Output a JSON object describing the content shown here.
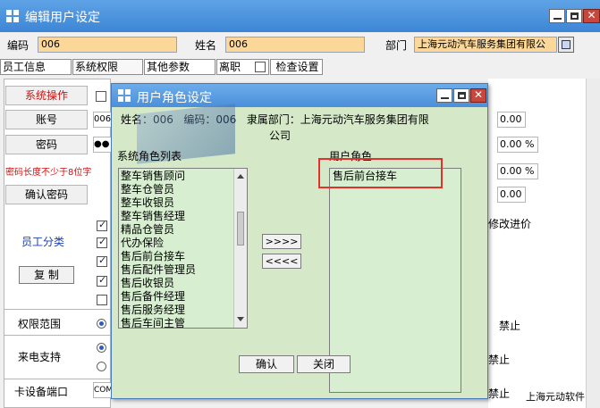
{
  "main_window": {
    "title": "编辑用户设定",
    "code_label": "编码",
    "code_value": "006",
    "name_label": "姓名",
    "name_value": "006",
    "dept_label": "部门",
    "dept_value": "上海元动汽车服务集团有限公",
    "tabs": [
      "员工信息",
      "系统权限",
      "其他参数",
      "离职",
      "检查设置"
    ],
    "rows": {
      "system_ops": "系统操作",
      "account": "账号",
      "account_value": "006",
      "password": "密码",
      "password_value": "●●",
      "password_hint": "密码长度不少于8位字",
      "confirm_password": "确认密码",
      "employee_class": "员工分类",
      "copy_button": "复 制",
      "permission_scope": "权限范围",
      "call_support": "来电支持",
      "card_port": "卡设备端口",
      "card_port_value": "COM"
    },
    "right_values": [
      "0.00",
      "0.00 %",
      "0.00 %",
      "0.00"
    ],
    "right_texts": {
      "modify_price": "修改进价",
      "forbid1": "禁止",
      "forbid2": "禁止",
      "forbid3": "禁止"
    },
    "footer_brand": "上海元动软件"
  },
  "dialog": {
    "title": "用户角色设定",
    "info_line1": "姓名：006   编码：006   隶属部门：上海元动汽车服务集团有限",
    "info_line2": "公司",
    "system_roles_label": "系统角色列表",
    "user_roles_label": "用户角色",
    "system_roles": [
      "整车销售顾问",
      "整车仓管员",
      "整车收银员",
      "整车销售经理",
      "精品仓管员",
      "代办保险",
      "售后前台接车",
      "售后配件管理员",
      "售后收银员",
      "售后备件经理",
      "售后服务经理",
      "售后车间主管"
    ],
    "user_roles": [
      "售后前台接车"
    ],
    "add_button": ">>>>",
    "remove_button": "<<<<",
    "ok_button": "确认",
    "close_button": "关闭"
  },
  "colors": {
    "title_bar": "#3d86d6",
    "dialog_bg": "#d5e9c9",
    "highlight": "#e3322b",
    "field_yellow": "#fbd79a"
  }
}
